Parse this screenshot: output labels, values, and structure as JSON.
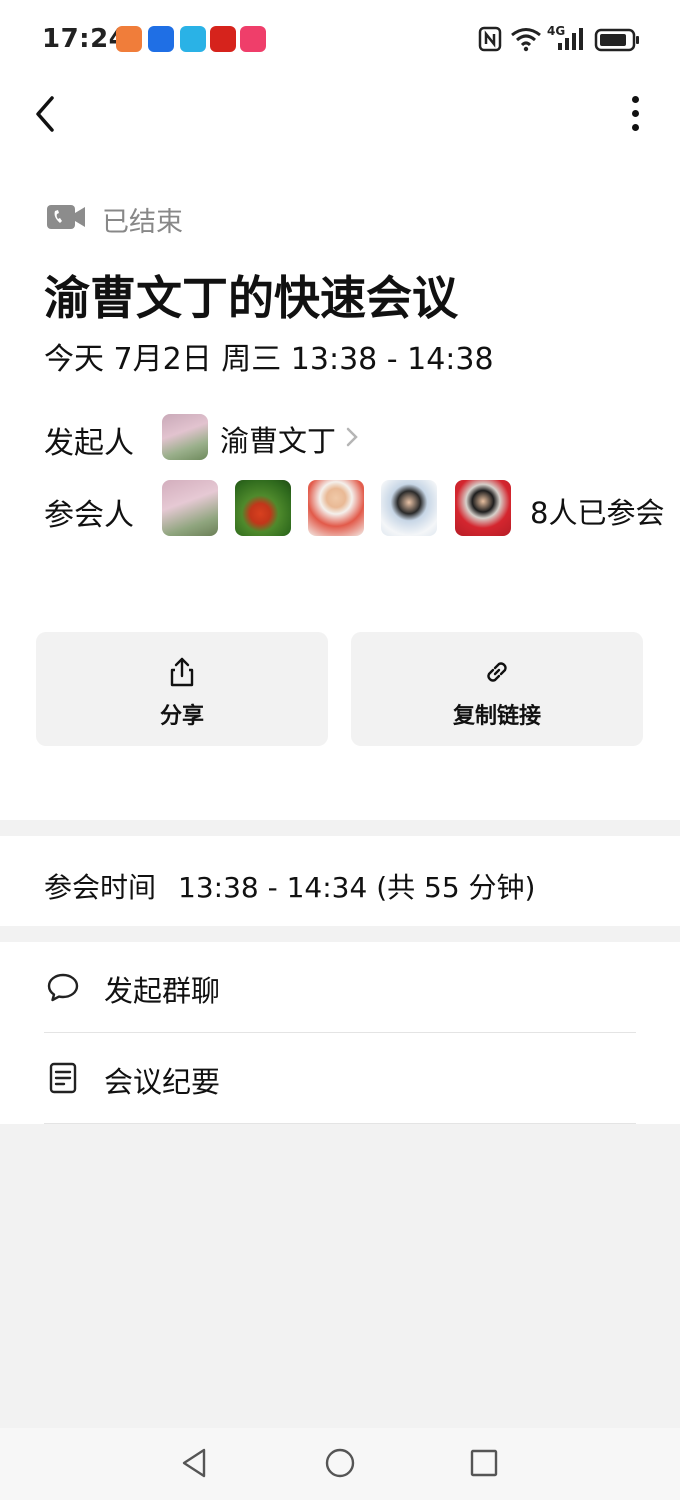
{
  "status_bar": {
    "time": "17:24",
    "network": "4G",
    "app_icons": [
      "taobao-icon",
      "qq-icon",
      "book-icon",
      "news-icon",
      "video-icon"
    ]
  },
  "header": {
    "back_icon": "chevron-left-icon",
    "more_icon": "more-vertical-icon"
  },
  "meeting": {
    "status": "已结束",
    "status_icon": "video-camera-icon",
    "title": "渝曹文丁的快速会议",
    "datetime": "今天 7月2日 周三 13:38 - 14:38",
    "host_label": "发起人",
    "host_name": "渝曹文丁",
    "participants_label": "参会人",
    "participants_count_text": "8人已参会",
    "participant_avatars": [
      "avatar-1",
      "avatar-2",
      "avatar-3",
      "avatar-4",
      "avatar-5"
    ]
  },
  "actions": {
    "share_label": "分享",
    "share_icon": "share-icon",
    "copy_link_label": "复制链接",
    "copy_link_icon": "link-icon"
  },
  "attendance": {
    "label": "参会时间",
    "value": "13:38 - 14:34 (共 55 分钟)"
  },
  "menu": {
    "items": [
      {
        "label": "发起群聊",
        "icon": "chat-bubble-icon"
      },
      {
        "label": "会议纪要",
        "icon": "document-icon"
      }
    ]
  },
  "colors": {
    "page_bg": "#f2f2f2",
    "card_bg": "#ffffff",
    "muted_text": "#888888",
    "button_bg": "#f2f2f2"
  }
}
